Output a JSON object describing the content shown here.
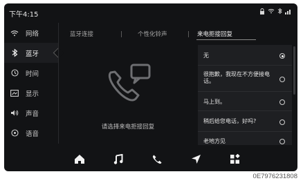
{
  "status_bar": {
    "time": "下午4:15",
    "icons": [
      "lock-icon",
      "wifi-icon",
      "bluetooth-icon",
      "signal-icon"
    ]
  },
  "sidebar": {
    "items": [
      {
        "label": "网络",
        "icon": "wifi-icon",
        "active": false
      },
      {
        "label": "蓝牙",
        "icon": "bluetooth-icon",
        "active": true
      },
      {
        "label": "时间",
        "icon": "clock-icon",
        "active": false
      },
      {
        "label": "显示",
        "icon": "display-icon",
        "active": false
      },
      {
        "label": "声音",
        "icon": "speaker-icon",
        "active": false
      },
      {
        "label": "语音",
        "icon": "voice-icon",
        "active": false
      }
    ]
  },
  "tabs": [
    {
      "label": "蓝牙连接",
      "active": false
    },
    {
      "label": "个性化铃声",
      "active": false
    },
    {
      "label": "来电拒接回复",
      "active": true
    }
  ],
  "hint": "请选择来电拒接回复",
  "replies": [
    {
      "text": "无",
      "selected": true
    },
    {
      "text": "很抱歉，我现在不方便接电话。",
      "selected": false
    },
    {
      "text": "马上到。",
      "selected": false
    },
    {
      "text": "稍后给您电话，好吗?",
      "selected": false
    },
    {
      "text": "老地方见",
      "selected": false
    }
  ],
  "dock": {
    "items": [
      "home-icon",
      "music-icon",
      "phone-icon",
      "navigation-icon",
      "apps-icon"
    ]
  },
  "caption": "0E7976231808",
  "colors": {
    "screen_bg": "#121315",
    "panel_bg": "#1e1f22",
    "text": "#dcdcdc"
  }
}
